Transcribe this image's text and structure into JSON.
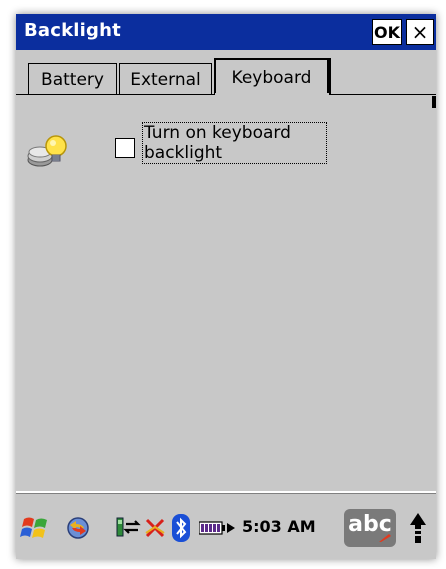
{
  "window": {
    "title": "Backlight",
    "ok_label": "OK",
    "close_label": "×"
  },
  "tabs": [
    {
      "label": "Battery",
      "selected": false
    },
    {
      "label": "External",
      "selected": false
    },
    {
      "label": "Keyboard",
      "selected": true
    }
  ],
  "keyboard_tab": {
    "icon": "lightbulb-icon",
    "checkbox_checked": false,
    "checkbox_label_line1": "Turn on keyboard",
    "checkbox_label_line2": "backlight"
  },
  "taskbar": {
    "start_icon": "windows-start-icon",
    "sync_icon": "sync-icon",
    "signal_icon": "signal-icon",
    "error_icon": "connection-error-icon",
    "bluetooth_icon": "bluetooth-icon",
    "battery_icon": "battery-icon",
    "time": "5:03 AM",
    "input_panel_label": "abc",
    "up_icon": "up-arrow-icon"
  },
  "colors": {
    "titlebar": "#0b2e9e",
    "background": "#c8c8c8",
    "input_panel": "#7a7a7a",
    "bluetooth": "#1a4fd6",
    "error": "#d8201a"
  }
}
